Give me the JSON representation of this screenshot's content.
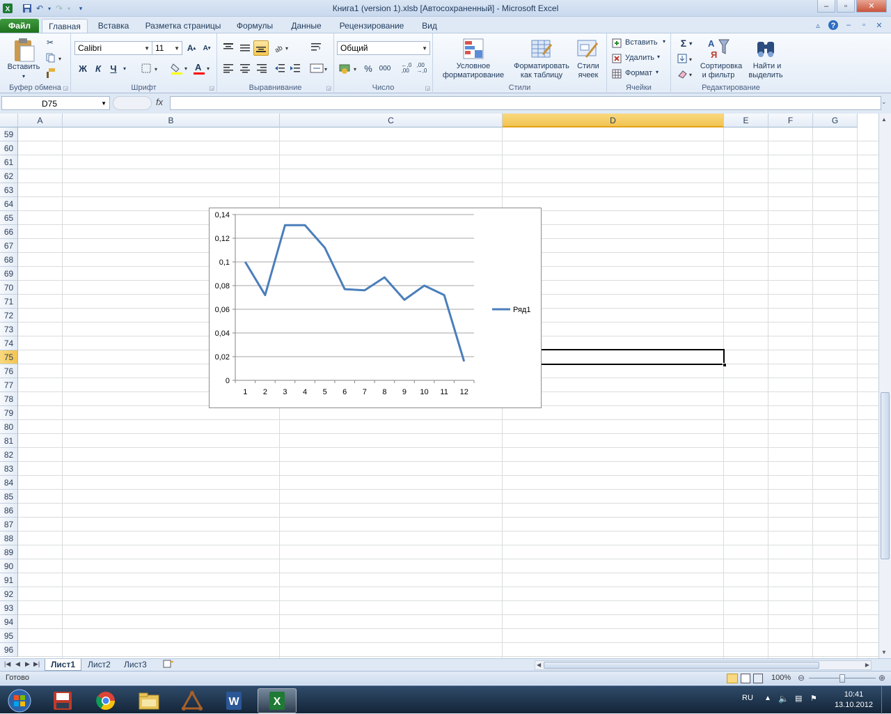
{
  "window": {
    "title": "Книга1 (version 1).xlsb [Автосохраненный]  -  Microsoft Excel"
  },
  "tabs": [
    "Файл",
    "Главная",
    "Вставка",
    "Разметка страницы",
    "Формулы",
    "Данные",
    "Рецензирование",
    "Вид"
  ],
  "ribbon": {
    "clipboard": {
      "paste": "Вставить",
      "group": "Буфер обмена"
    },
    "font": {
      "name": "Calibri",
      "size": "11",
      "bold": "Ж",
      "italic": "К",
      "underline": "Ч",
      "group": "Шрифт"
    },
    "alignment": {
      "group": "Выравнивание"
    },
    "number": {
      "format": "Общий",
      "percent": "%",
      "thousands": "000",
      "group": "Число"
    },
    "styles": {
      "conditional_1": "Условное",
      "conditional_2": "форматирование",
      "as_table_1": "Форматировать",
      "as_table_2": "как таблицу",
      "cell_styles_1": "Стили",
      "cell_styles_2": "ячеек",
      "group": "Стили"
    },
    "cells": {
      "insert": "Вставить",
      "delete": "Удалить",
      "format": "Формат",
      "group": "Ячейки"
    },
    "editing": {
      "sort_1": "Сортировка",
      "sort_2": "и фильтр",
      "find_1": "Найти и",
      "find_2": "выделить",
      "group": "Редактирование"
    }
  },
  "formula_bar": {
    "name_box": "D75",
    "fx": "fx",
    "value": ""
  },
  "columns": [
    "A",
    "B",
    "C",
    "D",
    "E",
    "F",
    "G"
  ],
  "rows": [
    "59",
    "60",
    "61",
    "62",
    "63",
    "64",
    "65",
    "66",
    "67",
    "68",
    "69",
    "70",
    "71",
    "72",
    "73",
    "74",
    "75",
    "76",
    "77",
    "78",
    "79",
    "80",
    "81",
    "82",
    "83",
    "84",
    "85",
    "86",
    "87",
    "88",
    "89",
    "90",
    "91",
    "92",
    "93",
    "94",
    "95",
    "96"
  ],
  "selected": {
    "column": "D",
    "row": "75"
  },
  "chart_data": {
    "type": "line",
    "categories": [
      "1",
      "2",
      "3",
      "4",
      "5",
      "6",
      "7",
      "8",
      "9",
      "10",
      "11",
      "12"
    ],
    "series": [
      {
        "name": "Ряд1",
        "color": "#4a7ebb",
        "values": [
          0.1,
          0.072,
          0.131,
          0.131,
          0.112,
          0.077,
          0.076,
          0.087,
          0.068,
          0.08,
          0.072,
          0.016
        ]
      }
    ],
    "yticks": [
      "0",
      "0,02",
      "0,04",
      "0,06",
      "0,08",
      "0,1",
      "0,12",
      "0,14"
    ],
    "ylim": [
      0,
      0.14
    ],
    "grid": true,
    "legend": "right"
  },
  "sheets": [
    "Лист1",
    "Лист2",
    "Лист3"
  ],
  "status": {
    "ready": "Готово",
    "zoom": "100%"
  },
  "tray": {
    "lang": "RU",
    "time": "10:41",
    "date": "13.10.2012"
  }
}
